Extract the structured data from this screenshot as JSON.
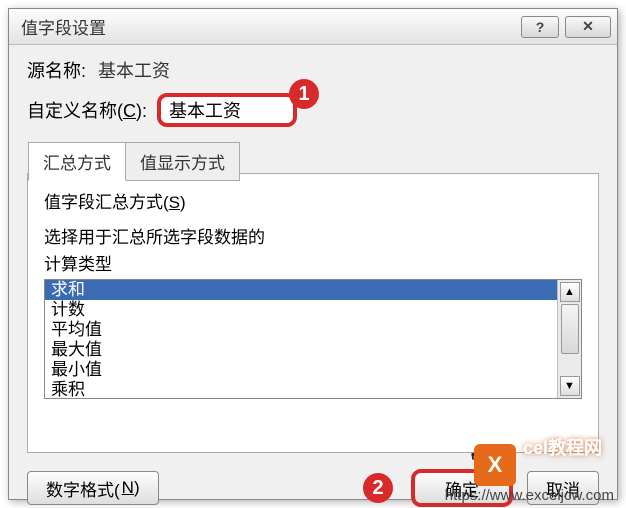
{
  "titlebar": {
    "title": "值字段设置",
    "help": "?",
    "close": "✕"
  },
  "source": {
    "label": "源名称:",
    "value": "基本工资"
  },
  "customName": {
    "label_pre": "自定义名称(",
    "label_u": "C",
    "label_post": "):",
    "value": "基本工资"
  },
  "callout1": "1",
  "callout2": "2",
  "tabs": {
    "summary": "汇总方式",
    "display": "值显示方式"
  },
  "summaryTab": {
    "heading_pre": "值字段汇总方式(",
    "heading_u": "S",
    "heading_post": ")",
    "desc": "选择用于汇总所选字段数据的",
    "calcLabel": "计算类型",
    "options": [
      "求和",
      "计数",
      "平均值",
      "最大值",
      "最小值",
      "乘积"
    ]
  },
  "buttons": {
    "format_pre": "数字格式(",
    "format_u": "N",
    "format_post": ")",
    "ok": "确定",
    "cancel": "取消"
  },
  "watermark": {
    "url": "https://www.exceljcw.com",
    "badge": "X",
    "text": "cel教程网"
  }
}
